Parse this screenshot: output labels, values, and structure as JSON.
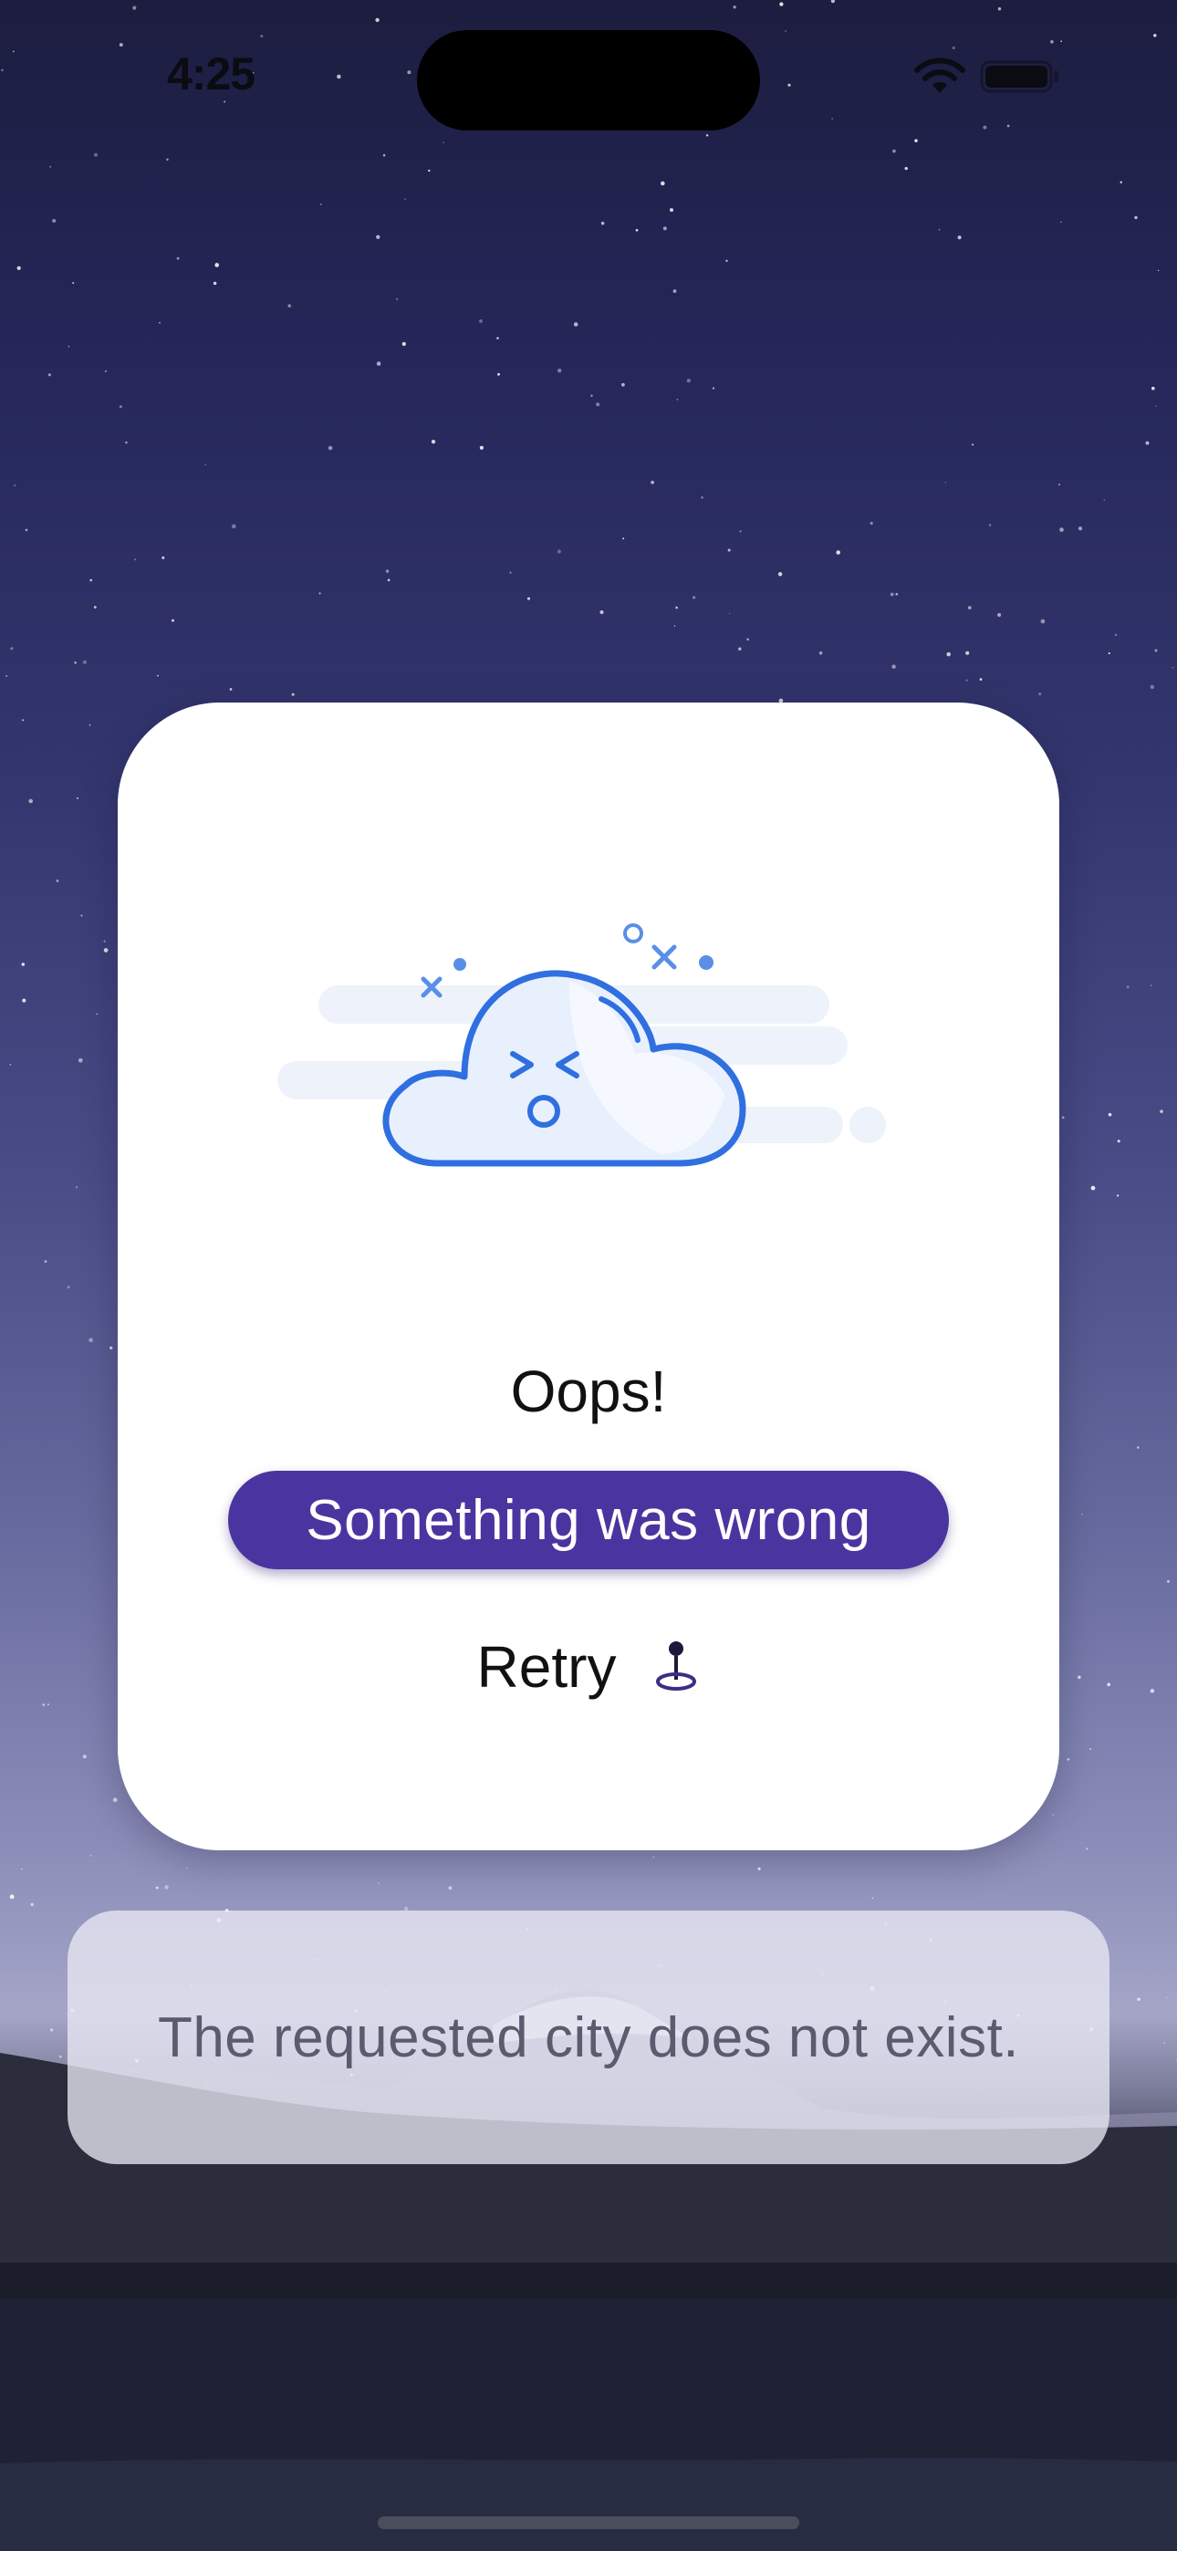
{
  "status_bar": {
    "time": "4:25",
    "icons": [
      "wifi-icon",
      "battery-icon"
    ]
  },
  "error_card": {
    "illustration": "sad-cloud-icon",
    "title": "Oops!",
    "subtitle": "Something was wrong",
    "retry_label": "Retry",
    "retry_icon": "location-pin-icon"
  },
  "message": {
    "text": "The requested city does not exist."
  },
  "colors": {
    "accent": "#4a35a0",
    "illustration_blue": "#2f6fe0",
    "card_background": "#ffffff"
  }
}
